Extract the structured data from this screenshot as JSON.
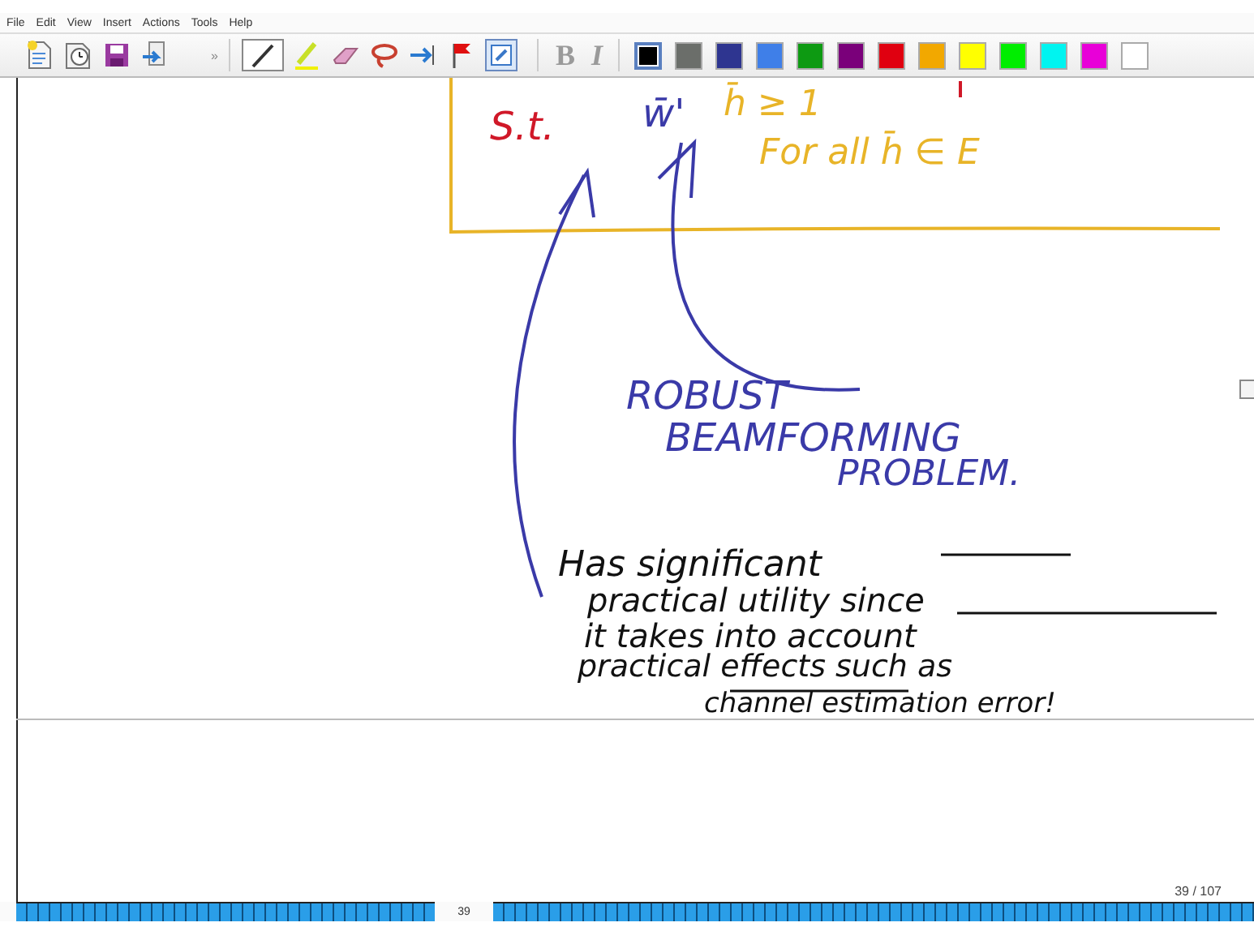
{
  "menu": [
    "File",
    "Edit",
    "View",
    "Insert",
    "Actions",
    "Tools",
    "Help"
  ],
  "toolbar": {
    "overflow": "»",
    "format": [
      {
        "label": "B",
        "disabled": true
      },
      {
        "label": "I",
        "disabled": true
      }
    ],
    "colors": [
      {
        "color": "#000000",
        "selected": true
      },
      {
        "color": "#6b6e6a",
        "selected": false
      },
      {
        "color": "#2e3590",
        "selected": false
      },
      {
        "color": "#3f7fe8",
        "selected": false
      },
      {
        "color": "#0d9a12",
        "selected": false
      },
      {
        "color": "#7a007a",
        "selected": false
      },
      {
        "color": "#e00010",
        "selected": false
      },
      {
        "color": "#f2a800",
        "selected": false
      },
      {
        "color": "#ffff00",
        "selected": false
      },
      {
        "color": "#00ee00",
        "selected": false
      },
      {
        "color": "#00f4f0",
        "selected": false
      },
      {
        "color": "#e800d8",
        "selected": false
      },
      {
        "color": "#ffffff",
        "selected": false
      }
    ]
  },
  "ink": [
    {
      "text": "S.t.",
      "color": "#d01828"
    },
    {
      "text": "w̄'",
      "color": "#3a3aa8"
    },
    {
      "text": "h̄ ≥ 1",
      "color": "#e8b428"
    },
    {
      "text": "For all h̄ ∈ E",
      "color": "#e8b428"
    },
    {
      "text": "ROBUST",
      "color": "#3a3aa8"
    },
    {
      "text": "BEAMFORMING",
      "color": "#3a3aa8"
    },
    {
      "text": "PROBLEM.",
      "color": "#3a3aa8"
    },
    {
      "text": "Has significant",
      "color": "#111111"
    },
    {
      "text": "practical utility since",
      "color": "#111111"
    },
    {
      "text": "it takes into account",
      "color": "#111111"
    },
    {
      "text": "practical effects such as",
      "color": "#111111"
    },
    {
      "text": "channel estimation error!",
      "color": "#111111"
    }
  ],
  "page_indicator": "39 / 107",
  "current_page": "39"
}
